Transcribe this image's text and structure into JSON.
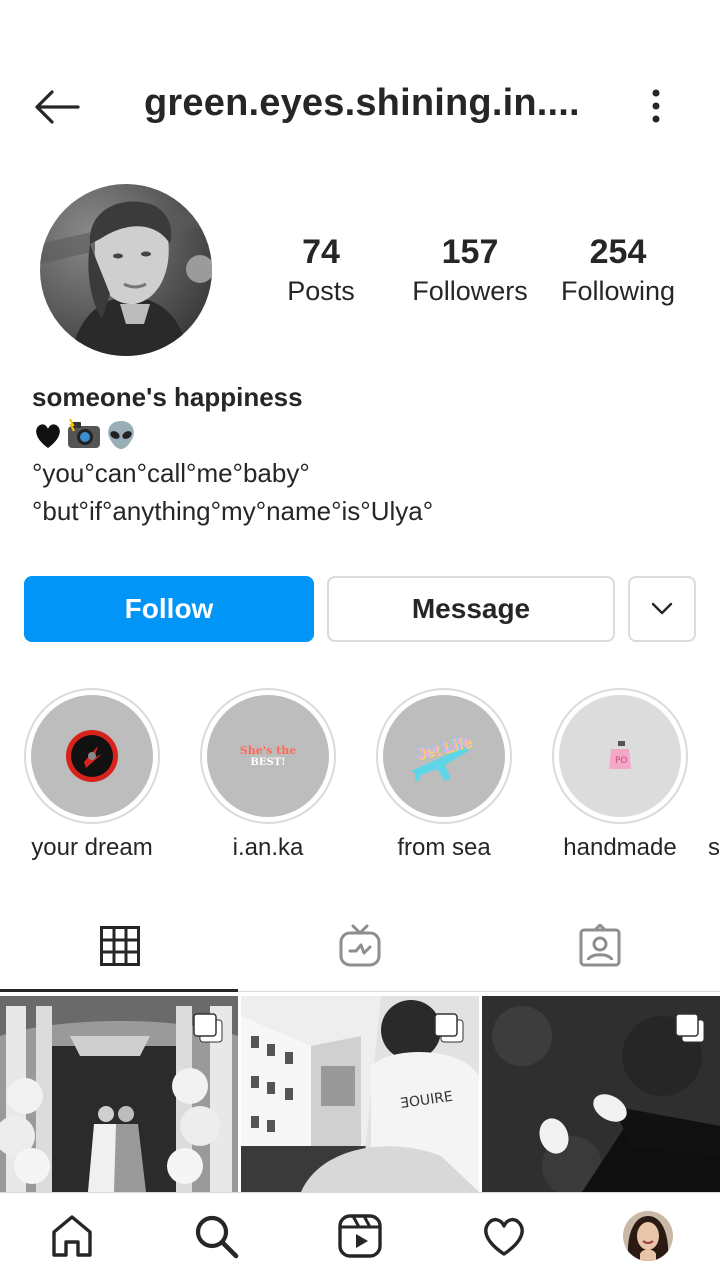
{
  "header": {
    "username": "green.eyes.shining.in....",
    "back_icon": "arrow-left-icon",
    "more_icon": "vertical-dots-icon"
  },
  "profile": {
    "posts_count": "74",
    "posts_label": "Posts",
    "followers_count": "157",
    "followers_label": "Followers",
    "following_count": "254",
    "following_label": "Following",
    "display_name": "someone's happiness",
    "bio_emojis": [
      "black-heart",
      "camera-with-flash",
      "alien"
    ],
    "bio_line_1": "°you°can°call°me°baby°",
    "bio_line_2": "°but°if°anything°my°name°is°Ulya°"
  },
  "actions": {
    "follow_label": "Follow",
    "message_label": "Message",
    "dropdown_icon": "chevron-down-icon",
    "accent_color": "#0095f6"
  },
  "highlights": [
    {
      "label": "your dream"
    },
    {
      "label": "i.an.ka",
      "cover_text_1": "She's the",
      "cover_text_2": "BEST!"
    },
    {
      "label": "from sea",
      "cover_text": "Jet Life"
    },
    {
      "label": "handmade"
    },
    {
      "label": "s"
    }
  ],
  "tabs": [
    {
      "icon": "grid-icon",
      "active": true
    },
    {
      "icon": "igtv-icon",
      "active": false
    },
    {
      "icon": "tagged-icon",
      "active": false
    }
  ],
  "posts": [
    {
      "type": "carousel",
      "subject": "two people under white columns with flowers"
    },
    {
      "type": "carousel",
      "subject": "girl with sunglasses sitting in front of building"
    },
    {
      "type": "carousel",
      "subject": "feet in white sneakers on grass"
    }
  ],
  "bottom_nav": [
    "home-icon",
    "search-icon",
    "reels-icon",
    "heart-icon",
    "profile-avatar"
  ]
}
